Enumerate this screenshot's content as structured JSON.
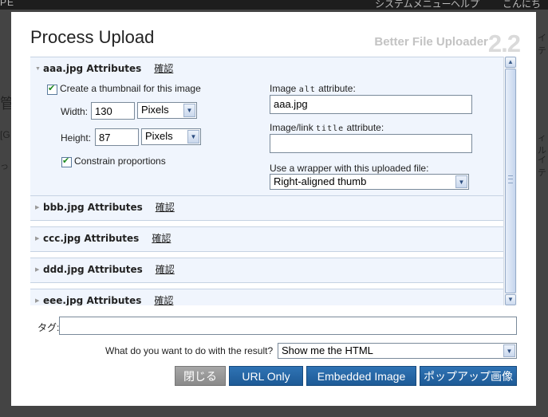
{
  "background": {
    "top_left": "PE",
    "top_mid": "システムメニュー",
    "top_help": "ヘルプ",
    "top_right": "こんにちは",
    "left_char_1": "管",
    "left_char_2": "[G",
    "left_char_3": "っ",
    "right_char_1": "イテ",
    "right_char_2": "ィル",
    "right_char_3": "イテ"
  },
  "dialog": {
    "title": "Process Upload",
    "brand_name": "Better File Uploader",
    "brand_version": "2.2"
  },
  "sections": [
    {
      "name": "aaa.jpg Attributes",
      "link": "確認",
      "expanded": true
    },
    {
      "name": "bbb.jpg Attributes",
      "link": "確認",
      "expanded": false
    },
    {
      "name": "ccc.jpg Attributes",
      "link": "確認",
      "expanded": false
    },
    {
      "name": "ddd.jpg Attributes",
      "link": "確認",
      "expanded": false
    },
    {
      "name": "eee.jpg Attributes",
      "link": "確認",
      "expanded": false
    }
  ],
  "thumbnail": {
    "create_label": "Create a thumbnail for this image",
    "create_checked": true,
    "width_label": "Width:",
    "width_value": "130",
    "width_unit": "Pixels",
    "height_label": "Height:",
    "height_value": "87",
    "height_unit": "Pixels",
    "constrain_label": "Constrain proportions",
    "constrain_checked": true
  },
  "attributes": {
    "alt_label_pre": "Image ",
    "alt_label_code": "alt",
    "alt_label_post": " attribute:",
    "alt_value": "aaa.jpg",
    "title_label_pre": "Image/link ",
    "title_label_code": "title",
    "title_label_post": " attribute:",
    "title_value": "",
    "wrapper_label": "Use a wrapper with this uploaded file:",
    "wrapper_value": "Right-aligned thumb"
  },
  "tag": {
    "label": "タグ:",
    "value": ""
  },
  "result": {
    "label": "What do you want to do with the result?",
    "value": "Show me the HTML"
  },
  "buttons": {
    "close": "閉じる",
    "url_only": "URL Only",
    "embedded": "Embedded Image",
    "popup": "ポップアップ画像"
  },
  "colors": {
    "section_bg": "#f0f5fd",
    "button_blue": "#1d5a96",
    "button_gray": "#8a8a8a"
  }
}
